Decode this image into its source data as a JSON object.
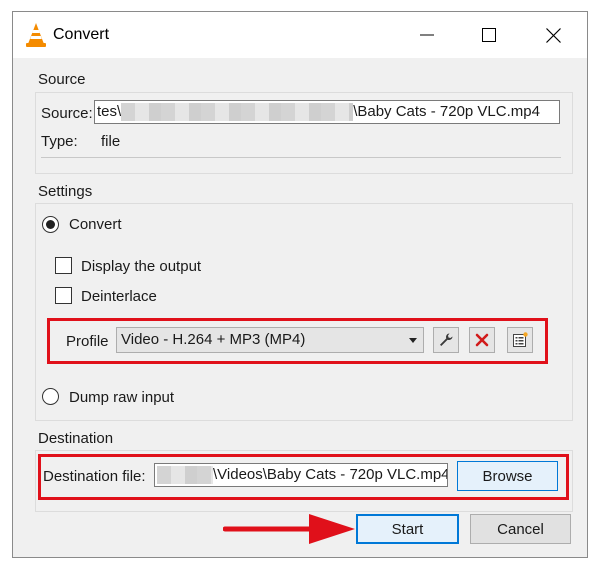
{
  "window": {
    "title": "Convert",
    "app_icon": "vlc-cone-icon"
  },
  "source": {
    "section": "Source",
    "source_label": "Source:",
    "source_path_prefix": "tes\\",
    "source_path_suffix": "\\Baby Cats - 720p VLC.mp4",
    "type_label": "Type:",
    "type_value": "file"
  },
  "settings": {
    "section": "Settings",
    "convert_label": "Convert",
    "convert_selected": true,
    "display_output_label": "Display the output",
    "display_output_checked": false,
    "deinterlace_label": "Deinterlace",
    "deinterlace_checked": false,
    "profile_label": "Profile",
    "profile_value": "Video - H.264 + MP3 (MP4)",
    "dump_raw_label": "Dump raw input",
    "dump_raw_selected": false
  },
  "destination": {
    "section": "Destination",
    "file_label": "Destination file:",
    "file_value": "\\Videos\\Baby Cats - 720p VLC.mp4",
    "browse_label": "Browse"
  },
  "footer": {
    "start_label": "Start",
    "cancel_label": "Cancel"
  },
  "colors": {
    "highlight": "#e0101a",
    "focus": "#0078d7"
  }
}
